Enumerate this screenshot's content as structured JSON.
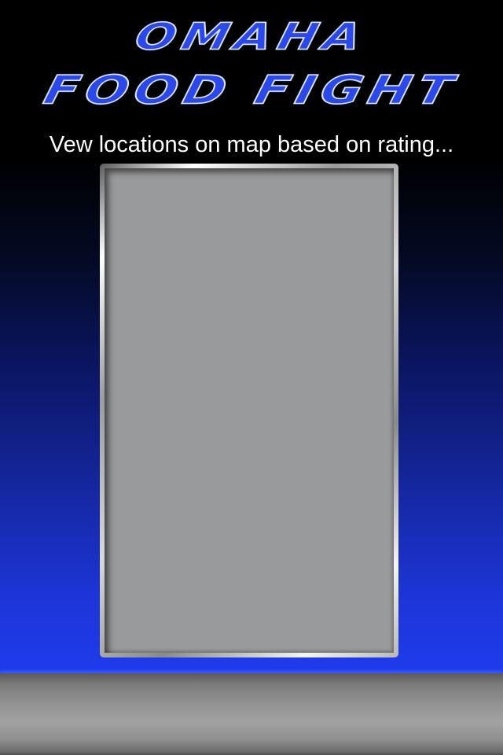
{
  "logo": {
    "line1": "OMAHA",
    "line2": "FOOD FIGHT"
  },
  "subtitle": "Vew locations on map based on rating...",
  "colors": {
    "logo_fill": "#2b48e8",
    "logo_outline": "#dfe4ff",
    "map_panel": "#999a9c",
    "bottom_bar": "#939393",
    "background_top": "#000000",
    "background_bottom": "#1f3bea"
  }
}
